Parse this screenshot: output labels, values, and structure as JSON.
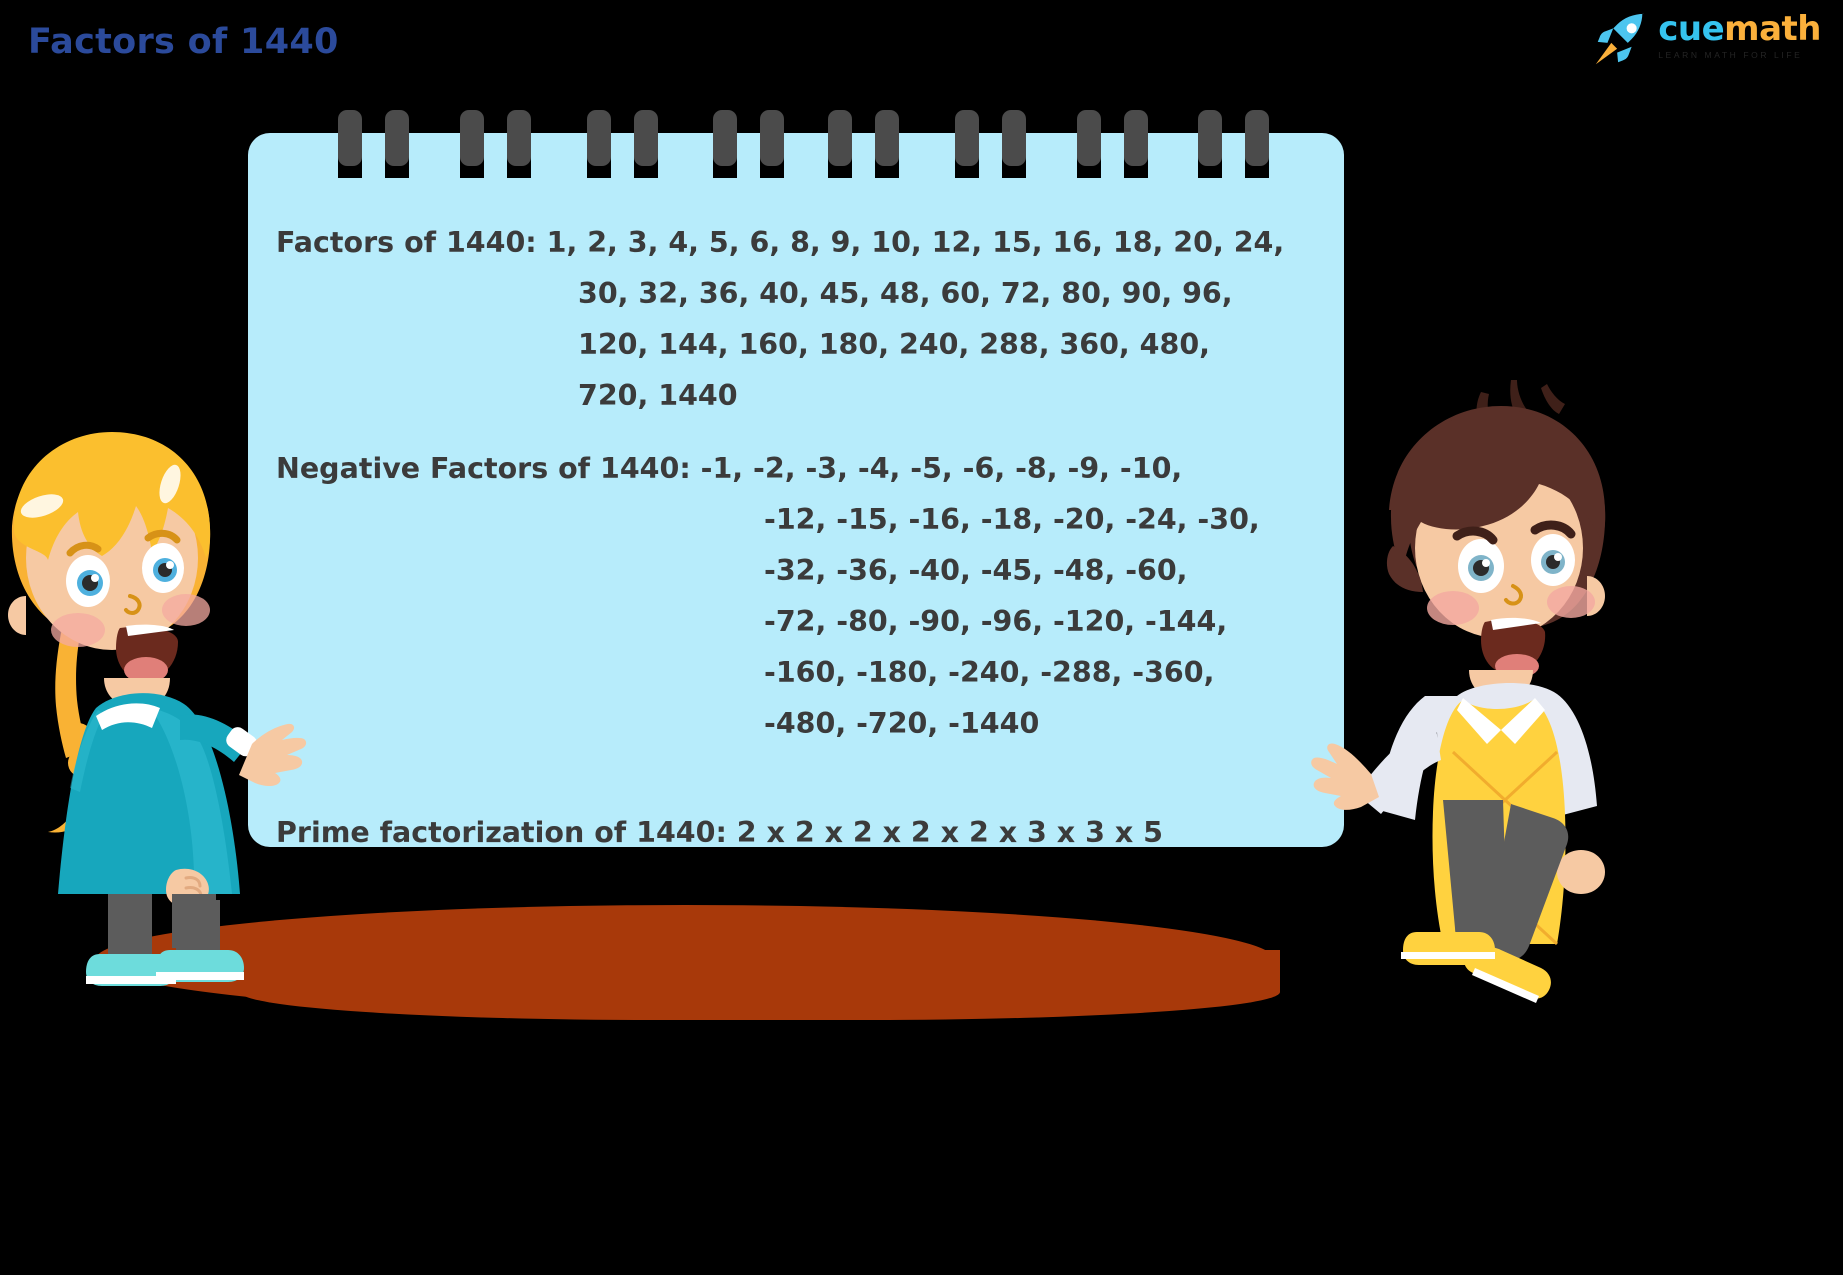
{
  "page": {
    "title": "Factors of 1440",
    "title_color": "#2b4a9b",
    "background_color": "#000000",
    "card_color": "#b7ecfb",
    "text_color": "#3b3b3b"
  },
  "logo": {
    "icon": "rocket-icon",
    "word_1": "cue",
    "word_2": "math",
    "word_1_color": "#35c3ef",
    "word_2_color": "#fbb03b",
    "tagline": "LEARN MATH FOR LIFE"
  },
  "card": {
    "positive": {
      "label": "Factors of 1440:",
      "lines": [
        "Factors of 1440: 1, 2, 3, 4, 5, 6, 8, 9, 10, 12, 15, 16, 18, 20, 24,",
        "30, 32, 36, 40, 45, 48, 60, 72, 80, 90, 96,",
        "120, 144, 160, 180, 240, 288, 360, 480,",
        "720, 1440"
      ],
      "values": [
        1,
        2,
        3,
        4,
        5,
        6,
        8,
        9,
        10,
        12,
        15,
        16,
        18,
        20,
        24,
        30,
        32,
        36,
        40,
        45,
        48,
        60,
        72,
        80,
        90,
        96,
        120,
        144,
        160,
        180,
        240,
        288,
        360,
        480,
        720,
        1440
      ]
    },
    "negative": {
      "label": "Negative Factors of 1440:",
      "lines": [
        "Negative Factors of 1440: -1, -2, -3, -4, -5, -6, -8, -9, -10,",
        "-12, -15, -16, -18, -20, -24, -30,",
        "-32, -36, -40, -45, -48, -60,",
        "-72, -80, -90, -96, -120, -144,",
        "-160, -180, -240, -288, -360,",
        "-480, -720, -1440"
      ],
      "values": [
        -1,
        -2,
        -3,
        -4,
        -5,
        -6,
        -8,
        -9,
        -10,
        -12,
        -15,
        -16,
        -18,
        -20,
        -24,
        -30,
        -32,
        -36,
        -40,
        -45,
        -48,
        -60,
        -72,
        -80,
        -90,
        -96,
        -120,
        -144,
        -160,
        -180,
        -240,
        -288,
        -360,
        -480,
        -720,
        -1440
      ]
    },
    "prime": {
      "line": "Prime factorization of 1440: 2 x 2 x 2 x 2 x 2 x 3 x 3 x 5",
      "label": "Prime factorization of 1440:",
      "expression": "2 x 2 x 2 x 2 x 2 x 3 x 3 x 5"
    },
    "ring_count": 8
  },
  "characters": {
    "left": {
      "name": "girl-character",
      "hair_color": "#f9b234",
      "shirt_color": "#1fa9bf",
      "pants_color": "#5c5c5c",
      "shoe_color": "#6ddcdc"
    },
    "right": {
      "name": "boy-character",
      "hair_color": "#5a3028",
      "vest_color": "#ffd23f",
      "pants_color": "#5c5c5c",
      "shoe_color": "#ffd23f"
    }
  },
  "ground": {
    "color": "#a8390a"
  }
}
